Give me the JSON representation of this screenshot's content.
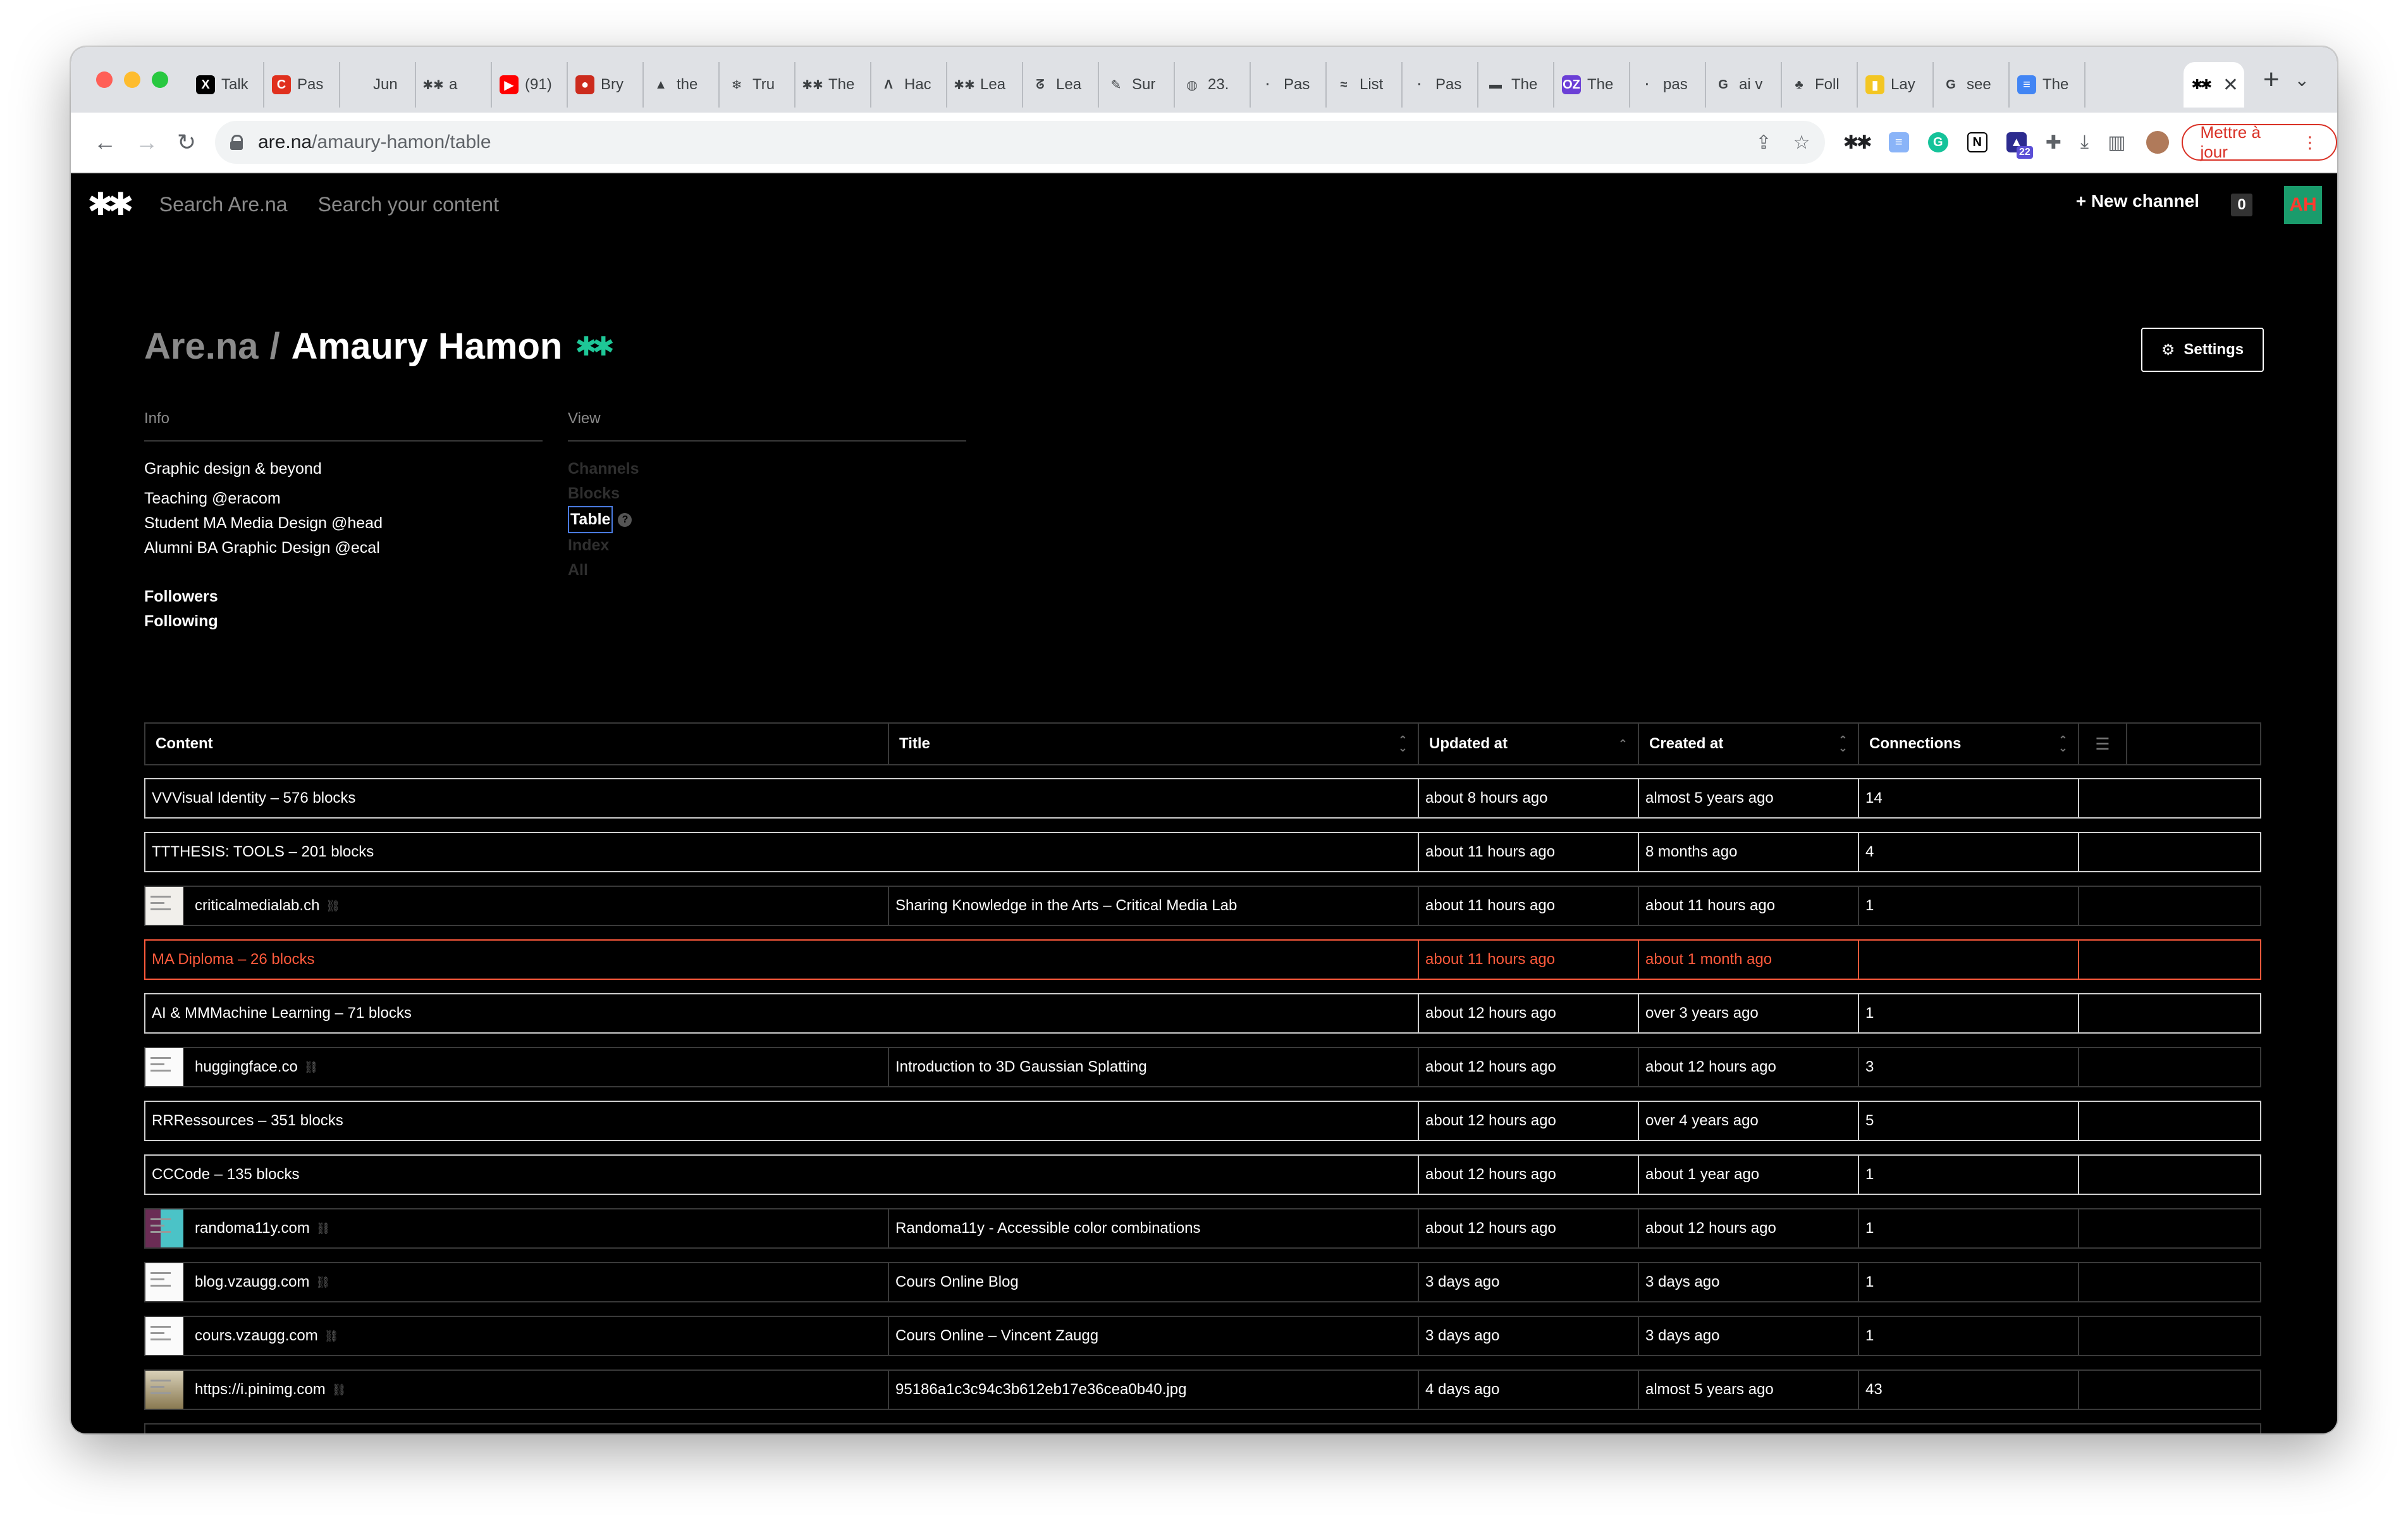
{
  "browser": {
    "tabs": [
      {
        "label": "Talk",
        "icon": "x-icon",
        "color": "#000000",
        "glyph": "X"
      },
      {
        "label": "Pas",
        "icon": "c-icon",
        "color": "#e0301e",
        "glyph": "C"
      },
      {
        "label": "Jun",
        "icon": "blank-icon",
        "color": "#dfe1e5",
        "glyph": ""
      },
      {
        "label": "a",
        "icon": "arena-icon",
        "color": "#dfe1e5",
        "glyph": "✱✱"
      },
      {
        "label": "(91)",
        "icon": "youtube-icon",
        "color": "#ff0000",
        "glyph": "▶"
      },
      {
        "label": "Bry",
        "icon": "red-circle-icon",
        "color": "#cc2b1d",
        "glyph": "●"
      },
      {
        "label": "the",
        "icon": "rocket-icon",
        "color": "#dfe1e5",
        "glyph": "▲"
      },
      {
        "label": "Tru",
        "icon": "snowflake-icon",
        "color": "#dfe1e5",
        "glyph": "❄"
      },
      {
        "label": "The",
        "icon": "arena-icon",
        "color": "#dfe1e5",
        "glyph": "✱✱"
      },
      {
        "label": "Hac",
        "icon": "a-icon",
        "color": "#dfe1e5",
        "glyph": "Λ"
      },
      {
        "label": "Lea",
        "icon": "arena-icon",
        "color": "#dfe1e5",
        "glyph": "✱✱"
      },
      {
        "label": "Lea",
        "icon": "swirl-icon",
        "color": "#dfe1e5",
        "glyph": "ᘔ"
      },
      {
        "label": "Sur",
        "icon": "feather-icon",
        "color": "#dfe1e5",
        "glyph": "✎"
      },
      {
        "label": "23.",
        "icon": "globe-icon",
        "color": "#dfe1e5",
        "glyph": "◍"
      },
      {
        "label": "Pas",
        "icon": "dot-icon",
        "color": "#dfe1e5",
        "glyph": "·"
      },
      {
        "label": "List",
        "icon": "wave-icon",
        "color": "#dfe1e5",
        "glyph": "≈"
      },
      {
        "label": "Pas",
        "icon": "dot-icon",
        "color": "#dfe1e5",
        "glyph": "·"
      },
      {
        "label": "The",
        "icon": "stripe-icon",
        "color": "#dfe1e5",
        "glyph": "▬"
      },
      {
        "label": "The",
        "icon": "oz-icon",
        "color": "#6b3fd6",
        "glyph": "OZ"
      },
      {
        "label": "pas",
        "icon": "dot-icon",
        "color": "#dfe1e5",
        "glyph": "·"
      },
      {
        "label": "ai v",
        "icon": "google-icon",
        "color": "#dfe1e5",
        "glyph": "G"
      },
      {
        "label": "Foll",
        "icon": "leaf-icon",
        "color": "#dfe1e5",
        "glyph": "♣"
      },
      {
        "label": "Lay",
        "icon": "folder-icon",
        "color": "#f3c623",
        "glyph": "▮"
      },
      {
        "label": "see",
        "icon": "google-icon",
        "color": "#dfe1e5",
        "glyph": "G"
      },
      {
        "label": "The",
        "icon": "docs-icon",
        "color": "#4285f4",
        "glyph": "≡"
      }
    ],
    "active_tab_icon": "arena-icon",
    "url_host": "are.na",
    "url_path": "/amaury-hamon/table",
    "update_label": "Mettre à jour",
    "extension_badge": "22"
  },
  "topnav": {
    "search_arena": "Search Are.na",
    "search_content": "Search your content",
    "new_channel": "New channel",
    "count": "0",
    "avatar": "AH"
  },
  "header": {
    "site": "Are.na",
    "separator": "/",
    "user": "Amaury Hamon",
    "settings": "Settings"
  },
  "info": {
    "heading": "Info",
    "tagline": "Graphic design & beyond",
    "lines": [
      "Teaching @eracom",
      "Student MA Media Design @head",
      "Alumni BA Graphic Design @ecal"
    ],
    "followers": "Followers",
    "following": "Following"
  },
  "view": {
    "heading": "View",
    "options": [
      "Channels",
      "Blocks",
      "Table",
      "Index",
      "All"
    ],
    "help": "?"
  },
  "table": {
    "columns": [
      "Content",
      "Title",
      "Updated at",
      "Created at",
      "Connections"
    ],
    "rows": [
      {
        "kind": "channel",
        "content": "VVVisual Identity – 576 blocks",
        "title": "",
        "updated": "about 8 hours ago",
        "created": "almost 5 years ago",
        "connections": "14"
      },
      {
        "kind": "channel",
        "content": "TTTHESIS: TOOLS – 201 blocks",
        "title": "",
        "updated": "about 11 hours ago",
        "created": "8 months ago",
        "connections": "4"
      },
      {
        "kind": "link",
        "thumb": "th-light",
        "content": "criticalmedialab.ch",
        "title": "Sharing Knowledge in the Arts – Critical Media Lab",
        "updated": "about 11 hours ago",
        "created": "about 11 hours ago",
        "connections": "1"
      },
      {
        "kind": "red",
        "content": "MA Diploma – 26 blocks",
        "title": "",
        "updated": "about 11 hours ago",
        "created": "about 1 month ago",
        "connections": ""
      },
      {
        "kind": "channel",
        "content": "AI & MMMachine Learning – 71 blocks",
        "title": "",
        "updated": "about 12 hours ago",
        "created": "over 3 years ago",
        "connections": "1"
      },
      {
        "kind": "link",
        "thumb": "th-white",
        "content": "huggingface.co",
        "title": "Introduction to 3D Gaussian Splatting",
        "updated": "about 12 hours ago",
        "created": "about 12 hours ago",
        "connections": "3"
      },
      {
        "kind": "channel",
        "content": "RRRessources – 351 blocks",
        "title": "",
        "updated": "about 12 hours ago",
        "created": "over 4 years ago",
        "connections": "5"
      },
      {
        "kind": "channel",
        "content": "CCCode – 135 blocks",
        "title": "",
        "updated": "about 12 hours ago",
        "created": "about 1 year ago",
        "connections": "1"
      },
      {
        "kind": "link",
        "thumb": "th-purple",
        "content": "randoma11y.com",
        "title": "Randoma11y - Accessible color combinations",
        "updated": "about 12 hours ago",
        "created": "about 12 hours ago",
        "connections": "1"
      },
      {
        "kind": "link",
        "thumb": "th-doc",
        "content": "blog.vzaugg.com",
        "title": "Cours Online Blog",
        "updated": "3 days ago",
        "created": "3 days ago",
        "connections": "1"
      },
      {
        "kind": "link",
        "thumb": "th-white",
        "content": "cours.vzaugg.com",
        "title": "Cours Online – Vincent Zaugg",
        "updated": "3 days ago",
        "created": "3 days ago",
        "connections": "1"
      },
      {
        "kind": "link",
        "thumb": "th-img",
        "content": "https://i.pinimg.com",
        "title": "95186a1c3c94c3b612eb17e36cea0b40.jpg",
        "updated": "4 days ago",
        "created": "almost 5 years ago",
        "connections": "43"
      }
    ],
    "more": "..."
  },
  "colors": {
    "accent_green": "#1ec797",
    "private_red": "#ff5a3c",
    "background": "#000000"
  }
}
